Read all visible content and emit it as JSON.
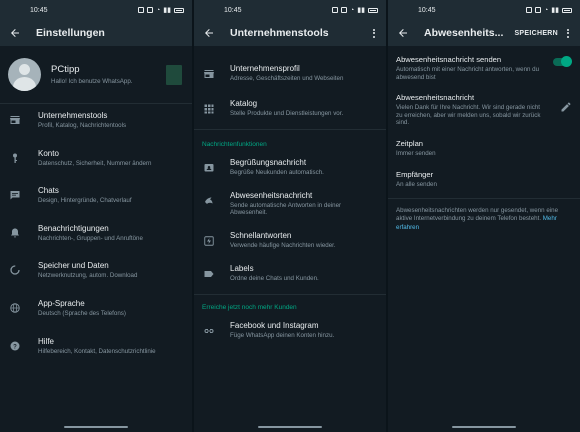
{
  "status_time": "10:45",
  "screens": {
    "settings": {
      "title": "Einstellungen",
      "profile": {
        "name": "PCtipp",
        "status": "Hallo! Ich benutze WhatsApp."
      },
      "items": [
        {
          "icon": "store-icon",
          "title": "Unternehmenstools",
          "subtitle": "Profil, Katalog, Nachrichtentools"
        },
        {
          "icon": "key-icon",
          "title": "Konto",
          "subtitle": "Datenschutz, Sicherheit, Nummer ändern"
        },
        {
          "icon": "chat-icon",
          "title": "Chats",
          "subtitle": "Design, Hintergründe, Chatverlauf"
        },
        {
          "icon": "bell-icon",
          "title": "Benachrichtigungen",
          "subtitle": "Nachrichten-, Gruppen- und Anruftöne"
        },
        {
          "icon": "storage-icon",
          "title": "Speicher und Daten",
          "subtitle": "Netzwerknutzung, autom. Download"
        },
        {
          "icon": "globe-icon",
          "title": "App-Sprache",
          "subtitle": "Deutsch (Sprache des Telefons)"
        },
        {
          "icon": "help-icon",
          "title": "Hilfe",
          "subtitle": "Hilfebereich, Kontakt, Datenschutzrichtlinie"
        }
      ]
    },
    "tools": {
      "title": "Unternehmenstools",
      "items_top": [
        {
          "icon": "store-icon",
          "title": "Unternehmensprofil",
          "subtitle": "Adresse, Geschäftszeiten und Webseiten"
        },
        {
          "icon": "catalog-icon",
          "title": "Katalog",
          "subtitle": "Stelle Produkte und Dienstleistungen vor."
        }
      ],
      "section_messaging": "Nachrichtenfunktionen",
      "items_messaging": [
        {
          "icon": "greeting-icon",
          "title": "Begrüßungsnachricht",
          "subtitle": "Begrüße Neukunden automatisch."
        },
        {
          "icon": "away-icon",
          "title": "Abwesenheitsnachricht",
          "subtitle": "Sende automatische Antworten in deiner Abwesenheit."
        },
        {
          "icon": "quick-reply-icon",
          "title": "Schnellantworten",
          "subtitle": "Verwende häufige Nachrichten wieder."
        },
        {
          "icon": "label-icon",
          "title": "Labels",
          "subtitle": "Ordne deine Chats und Kunden."
        }
      ],
      "section_reach": "Erreiche jetzt noch mehr Kunden",
      "items_reach": [
        {
          "icon": "link-icon",
          "title": "Facebook und Instagram",
          "subtitle": "Füge WhatsApp deinen Konten hinzu."
        }
      ]
    },
    "away": {
      "title": "Abwesenheits...",
      "save_label": "SPEICHERN",
      "send": {
        "title": "Abwesenheitsnachricht senden",
        "subtitle": "Automatisch mit einer Nachricht antworten, wenn du abwesend bist",
        "enabled": true
      },
      "message": {
        "title": "Abwesenheitsnachricht",
        "subtitle": "Vielen Dank für Ihre Nachricht. Wir sind gerade nicht zu erreichen, aber wir melden uns, sobald wir zurück sind."
      },
      "schedule": {
        "title": "Zeitplan",
        "subtitle": "Immer senden"
      },
      "recipients": {
        "title": "Empfänger",
        "subtitle": "An alle senden"
      },
      "info_text": "Abwesenheitsnachrichten werden nur gesendet, wenn eine aktive Internetverbindung zu deinem Telefon besteht.",
      "info_link": "Mehr erfahren"
    }
  },
  "colors": {
    "accent": "#00a884",
    "background": "#121b22",
    "appbar": "#1f2c34",
    "text_secondary": "#8696a0",
    "link": "#53bdeb"
  }
}
